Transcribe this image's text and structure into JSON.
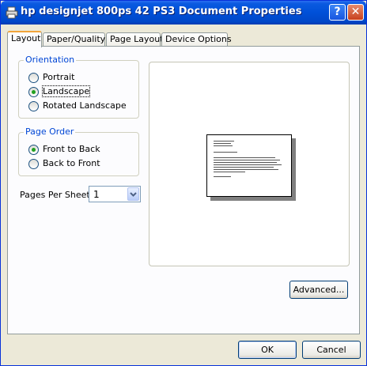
{
  "window": {
    "title": "hp designjet 800ps 42 PS3 Document Properties",
    "help_glyph": "?",
    "close_glyph": "✕"
  },
  "tabs": [
    "Layout",
    "Paper/Quality",
    "Page Layout",
    "Device Options"
  ],
  "orientation": {
    "label": "Orientation",
    "options": [
      "Portrait",
      "Landscape",
      "Rotated Landscape"
    ],
    "selected": "Landscape"
  },
  "page_order": {
    "label": "Page Order",
    "options": [
      "Front to Back",
      "Back to Front"
    ],
    "selected": "Front to Back"
  },
  "pages_per_sheet": {
    "label": "Pages Per Sheet:",
    "value": "1"
  },
  "buttons": {
    "advanced": "Advanced...",
    "ok": "OK",
    "cancel": "Cancel"
  },
  "colors": {
    "accent": "#0046d5",
    "title_bar": "#0050d8",
    "tab_highlight": "#f1a43a",
    "radio_dot": "#21a121"
  },
  "icons": [
    "printer-icon",
    "help-icon",
    "close-icon",
    "chevron-down-icon"
  ]
}
